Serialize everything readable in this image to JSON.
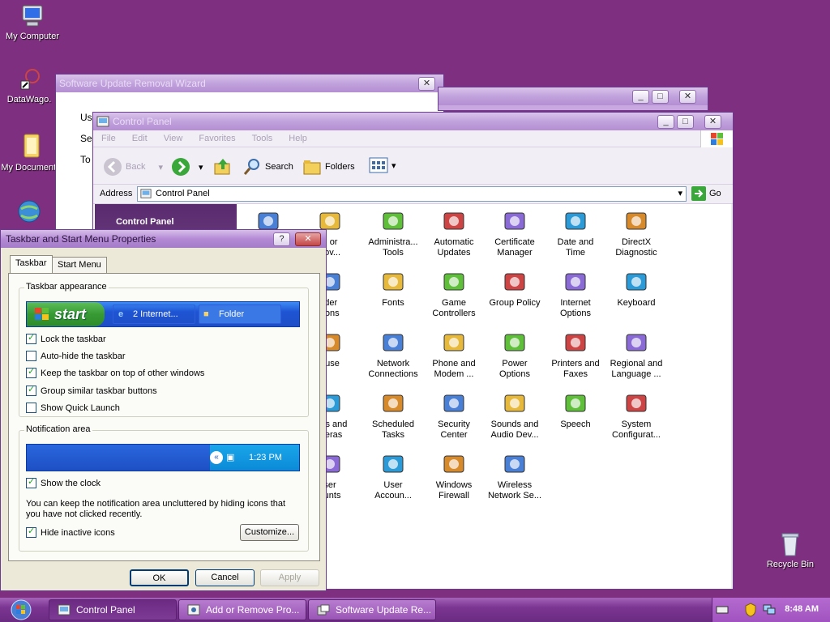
{
  "desktop": {
    "icons": [
      {
        "label": "My Computer"
      },
      {
        "label": "DataWago."
      },
      {
        "label": "My Documents"
      },
      {
        "label": "Recycle Bin"
      }
    ]
  },
  "wizard": {
    "title": "Software Update Removal Wizard",
    "lines": [
      "Us",
      "Se",
      "To"
    ]
  },
  "control_panel": {
    "title": "Control Panel",
    "menu": [
      "File",
      "Edit",
      "View",
      "Favorites",
      "Tools",
      "Help"
    ],
    "toolbar": {
      "back": "Back",
      "search": "Search",
      "folders": "Folders"
    },
    "address_label": "Address",
    "address_value": "Control Panel",
    "go_label": "Go",
    "sidebar_title": "Control Panel",
    "items": [
      {
        "label": "",
        "icon": "install-icon"
      },
      {
        "label": "d or\nnov...",
        "icon": "add-remove-icon"
      },
      {
        "label": "Administra...\nTools",
        "icon": "admin-tools-icon"
      },
      {
        "label": "Automatic\nUpdates",
        "icon": "globe-icon"
      },
      {
        "label": "Certificate\nManager",
        "icon": "certificate-icon"
      },
      {
        "label": "Date and\nTime",
        "icon": "clock-icon"
      },
      {
        "label": "DirectX\nDiagnostic",
        "icon": "directx-icon"
      },
      {
        "label": "lder\ntions",
        "icon": "folder-options-icon"
      },
      {
        "label": "Fonts",
        "icon": "fonts-folder-icon"
      },
      {
        "label": "Game\nControllers",
        "icon": "gamepad-icon"
      },
      {
        "label": "Group Policy",
        "icon": "group-policy-icon"
      },
      {
        "label": "Internet\nOptions",
        "icon": "internet-options-icon"
      },
      {
        "label": "Keyboard",
        "icon": "keyboard-icon"
      },
      {
        "label": "ouse",
        "icon": "mouse-icon"
      },
      {
        "label": "Network\nConnections",
        "icon": "network-icon"
      },
      {
        "label": "Phone and\nModem ...",
        "icon": "phone-icon"
      },
      {
        "label": "Power\nOptions",
        "icon": "power-icon"
      },
      {
        "label": "Printers and\nFaxes",
        "icon": "printer-icon"
      },
      {
        "label": "Regional and\nLanguage ...",
        "icon": "regional-icon"
      },
      {
        "label": "ners and\nmeras",
        "icon": "scanner-icon"
      },
      {
        "label": "Scheduled\nTasks",
        "icon": "scheduled-tasks-icon"
      },
      {
        "label": "Security\nCenter",
        "icon": "security-shield-icon"
      },
      {
        "label": "Sounds and\nAudio Dev...",
        "icon": "speaker-icon"
      },
      {
        "label": "Speech",
        "icon": "speech-icon"
      },
      {
        "label": "System\nConfigurat...",
        "icon": "system-config-icon"
      },
      {
        "label": "ser\nounts",
        "icon": "users-icon"
      },
      {
        "label": "User\nAccoun...",
        "icon": "user-accounts-icon"
      },
      {
        "label": "Windows\nFirewall",
        "icon": "firewall-icon"
      },
      {
        "label": "Wireless\nNetwork Se...",
        "icon": "wireless-icon"
      }
    ]
  },
  "taskbar_props": {
    "title": "Taskbar and Start Menu Properties",
    "tabs": [
      "Taskbar",
      "Start Menu"
    ],
    "appearance_label": "Taskbar appearance",
    "preview": {
      "start": "start",
      "task1": "2 Internet...",
      "task2": "Folder"
    },
    "checks": [
      {
        "label": "Lock the taskbar",
        "checked": true
      },
      {
        "label": "Auto-hide the taskbar",
        "checked": false
      },
      {
        "label": "Keep the taskbar on top of other windows",
        "checked": true
      },
      {
        "label": "Group similar taskbar buttons",
        "checked": true
      },
      {
        "label": "Show Quick Launch",
        "checked": false
      }
    ],
    "notification_label": "Notification area",
    "notif_time": "1:23 PM",
    "show_clock": "Show the clock",
    "notif_text": "You can keep the notification area uncluttered by hiding icons that you have not clicked recently.",
    "hide_inactive": "Hide inactive icons",
    "customize": "Customize...",
    "ok": "OK",
    "cancel": "Cancel",
    "apply": "Apply"
  },
  "taskbar": {
    "tasks": [
      "Control Panel",
      "Add or Remove Pro...",
      "Software Update Re..."
    ],
    "clock": "8:48 AM"
  }
}
